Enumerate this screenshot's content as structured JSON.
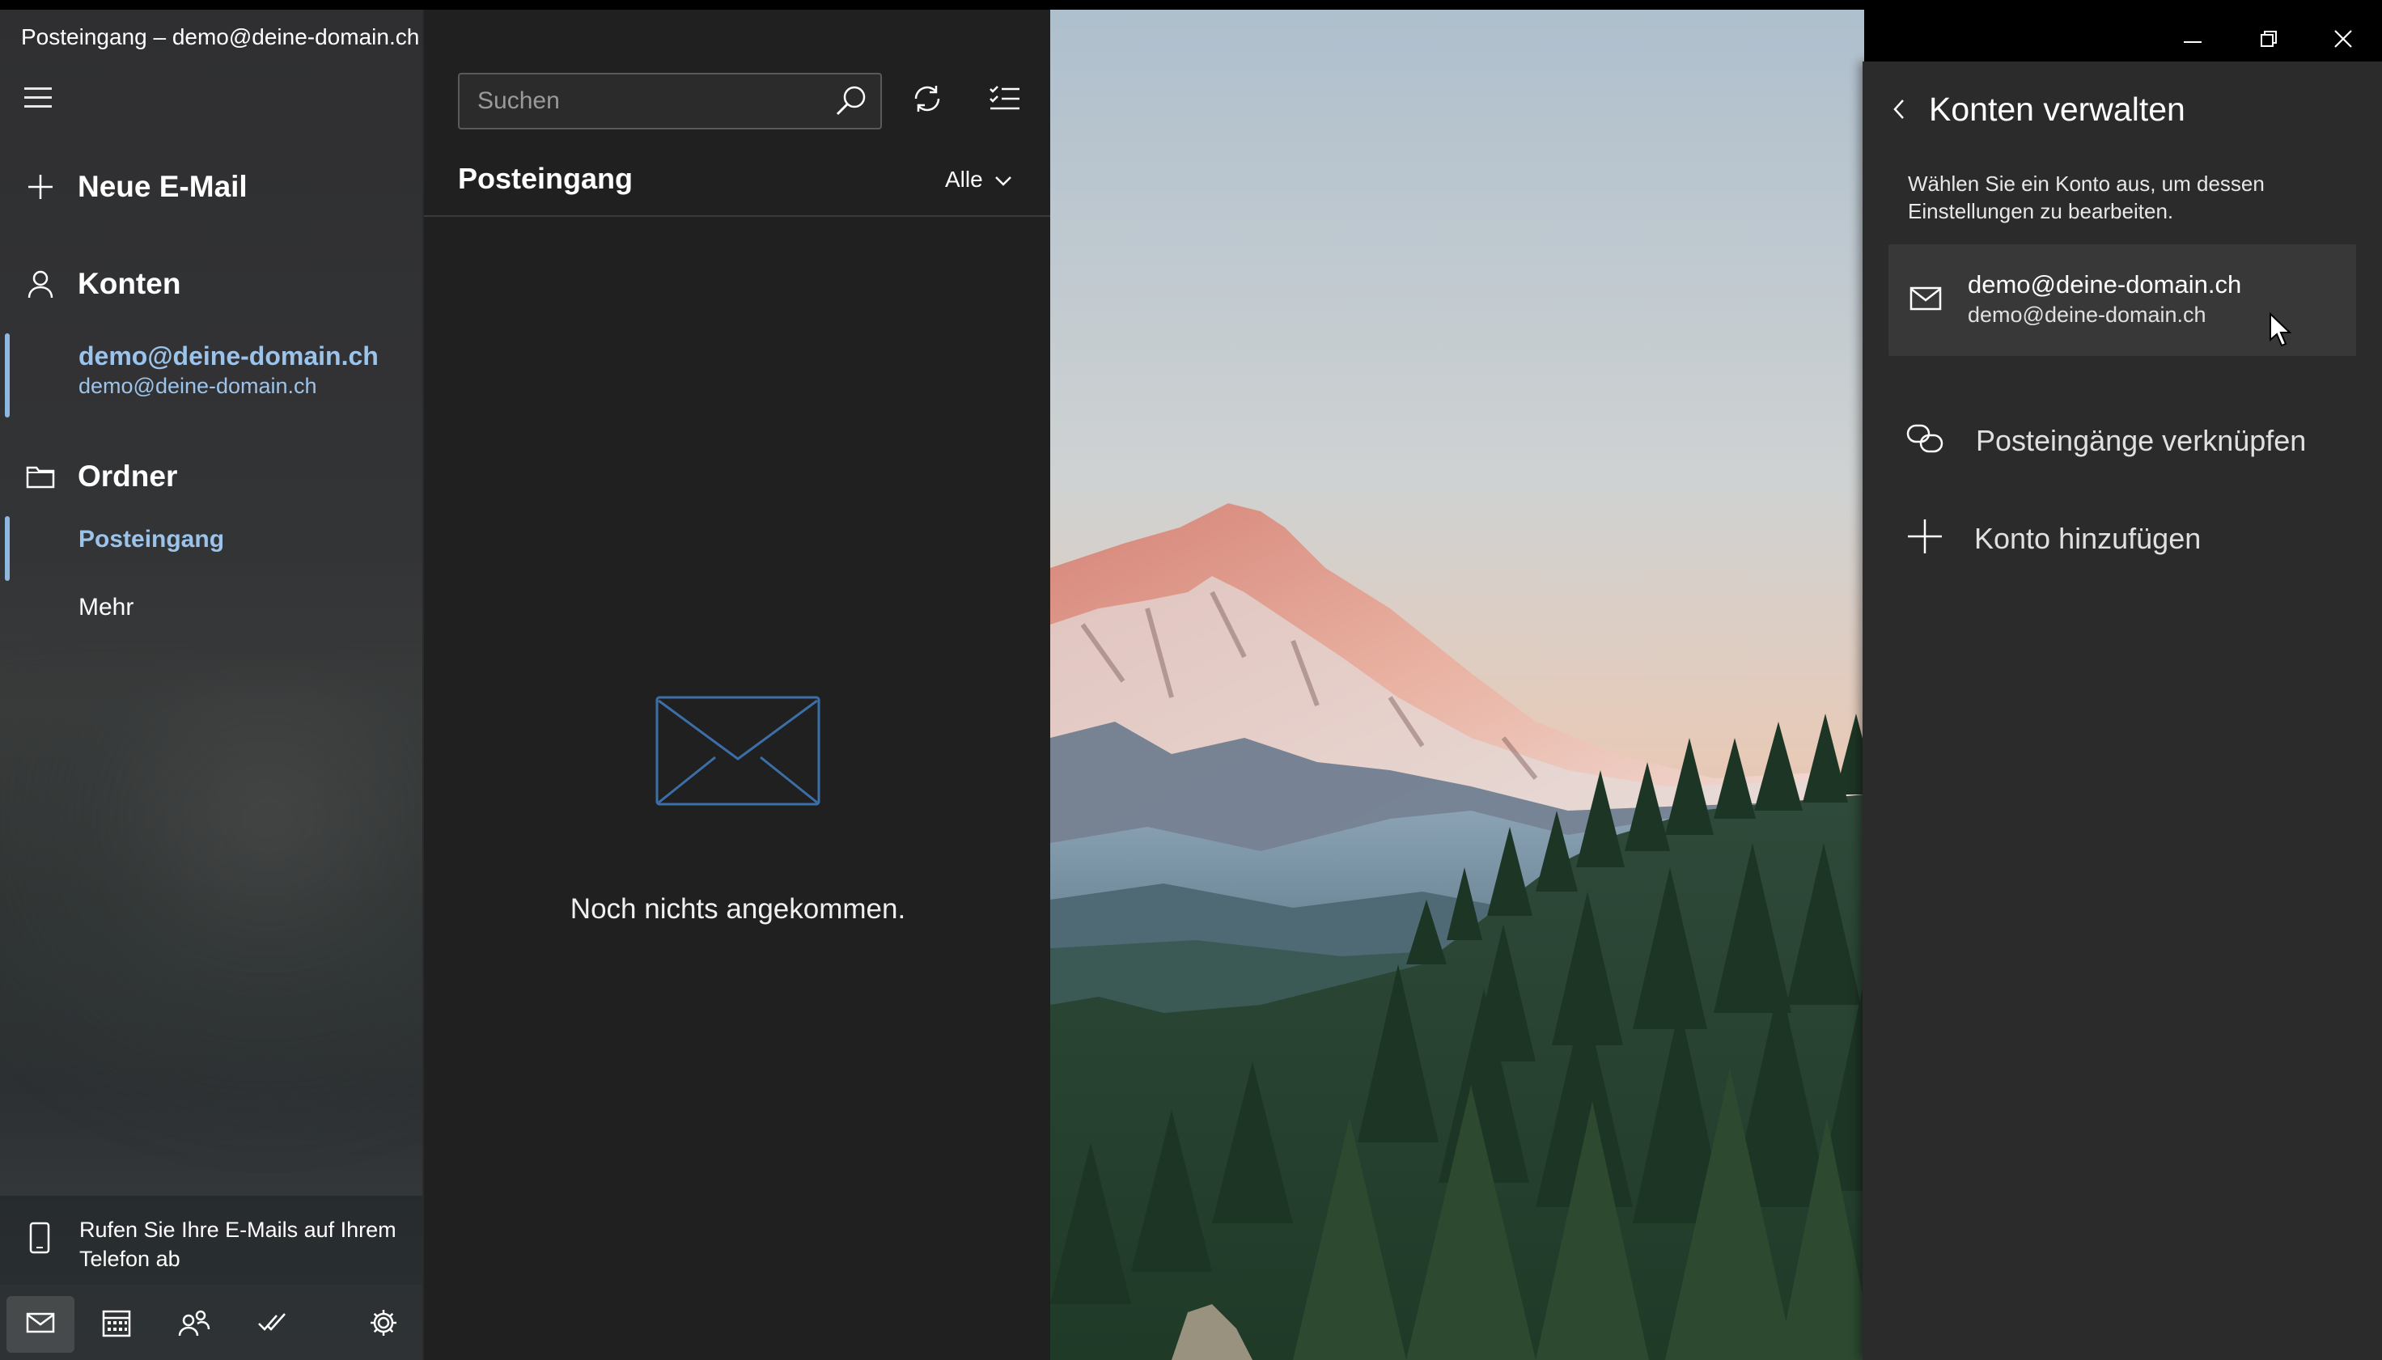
{
  "window": {
    "title": "Posteingang – demo@deine-domain.ch"
  },
  "sidebar": {
    "new_mail": "Neue E-Mail",
    "accounts_label": "Konten",
    "account": {
      "name": "demo@deine-domain.ch",
      "email": "demo@deine-domain.ch"
    },
    "folders_label": "Ordner",
    "folders": [
      {
        "label": "Posteingang"
      },
      {
        "label": "Mehr"
      }
    ],
    "promo": "Rufen Sie Ihre E-Mails auf Ihrem Telefon ab",
    "bottom_nav": [
      "mail-icon",
      "calendar-icon",
      "people-icon",
      "todo-icon",
      "settings-icon"
    ]
  },
  "list": {
    "search_placeholder": "Suchen",
    "title": "Posteingang",
    "filter": "Alle",
    "empty_text": "Noch nichts angekommen."
  },
  "panel": {
    "title": "Konten verwalten",
    "description": "Wählen Sie ein Konto aus, um dessen Einstellungen zu bearbeiten.",
    "account": {
      "name": "demo@deine-domain.ch",
      "email": "demo@deine-domain.ch"
    },
    "link_inboxes": "Posteingänge verknüpfen",
    "add_account": "Konto hinzufügen"
  },
  "colors": {
    "accent": "#9cc3ea",
    "panel_bg": "#2b2b2b",
    "list_bg": "#202020"
  }
}
